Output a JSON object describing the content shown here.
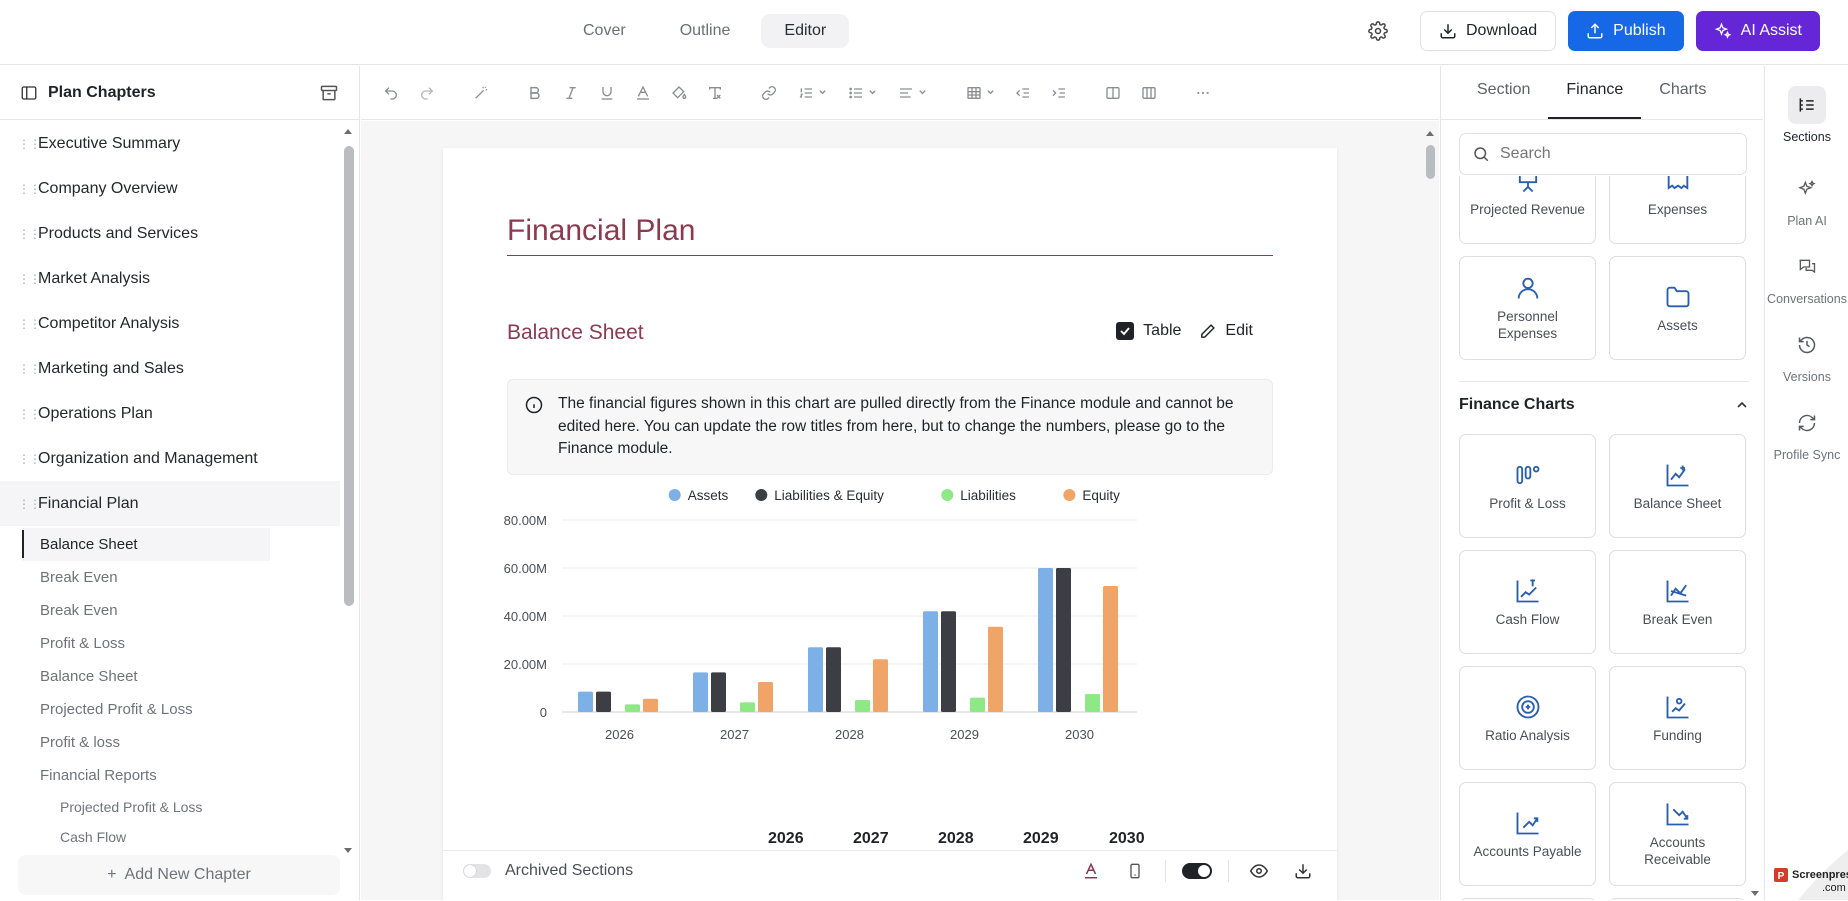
{
  "top_tabs": [
    {
      "label": "Cover",
      "active": false
    },
    {
      "label": "Outline",
      "active": false
    },
    {
      "label": "Editor",
      "active": true
    }
  ],
  "actions": {
    "download": "Download",
    "publish": "Publish",
    "ai_assist": "AI Assist"
  },
  "sidebar": {
    "title": "Plan Chapters",
    "chapters": [
      "Executive Summary",
      "Company Overview",
      "Products and Services",
      "Market Analysis",
      "Competitor Analysis",
      "Marketing and Sales",
      "Operations Plan",
      "Organization and Management",
      "Financial Plan"
    ],
    "sub_items": [
      "Balance Sheet",
      "Break Even",
      "Break Even",
      "Profit & Loss",
      "Balance Sheet",
      "Projected Profit & Loss",
      "Profit & loss",
      "Financial Reports"
    ],
    "sub_sub_items": [
      "Projected Profit & Loss",
      "Cash Flow"
    ],
    "add_chapter": "Add New Chapter"
  },
  "document": {
    "title": "Financial Plan",
    "section_title": "Balance Sheet",
    "table_label": "Table",
    "edit_label": "Edit",
    "info_text": "The financial figures shown in this chart are pulled directly from the Finance module and cannot be edited here. You can update the row titles from here, but to change the numbers, please go to the Finance module.",
    "table_years": [
      "2026",
      "2027",
      "2028",
      "2029",
      "2030"
    ],
    "archived_label": "Archived Sections"
  },
  "chart_data": {
    "type": "bar",
    "categories": [
      "2026",
      "2027",
      "2028",
      "2029",
      "2030"
    ],
    "series": [
      {
        "name": "Assets",
        "color": "#7db0e6",
        "values": [
          8.5,
          16.5,
          27,
          42,
          60
        ]
      },
      {
        "name": "Liabilities & Equity",
        "color": "#3c3e44",
        "values": [
          8.5,
          16.5,
          27,
          42,
          60
        ]
      },
      {
        "name": "Liabilities",
        "color": "#8ee886",
        "values": [
          3.2,
          4,
          5,
          6,
          7.5
        ]
      },
      {
        "name": "Equity",
        "color": "#f0a468",
        "values": [
          5.5,
          12.5,
          22,
          35.5,
          52.5
        ]
      }
    ],
    "ylim": [
      0,
      80
    ],
    "ytick_values": [
      0,
      20,
      40,
      60,
      80
    ],
    "ytick_labels": [
      "0",
      "20.00M",
      "40.00M",
      "60.00M",
      "80.00M"
    ],
    "legend_position": "top-right",
    "grid": true
  },
  "right_panel": {
    "tabs": [
      {
        "label": "Section",
        "active": false
      },
      {
        "label": "Finance",
        "active": true
      },
      {
        "label": "Charts",
        "active": false
      }
    ],
    "search_placeholder": "Search",
    "top_cards": [
      {
        "label": "Projected Revenue",
        "icon": "revenue-icon"
      },
      {
        "label": "Expenses",
        "icon": "expenses-icon"
      },
      {
        "label": "Personnel Expenses",
        "icon": "user-icon"
      },
      {
        "label": "Assets",
        "icon": "folder-icon"
      }
    ],
    "group_title": "Finance Charts",
    "chart_cards": [
      {
        "label": "Profit & Loss",
        "icon": "profit-loss-icon"
      },
      {
        "label": "Balance Sheet",
        "icon": "balance-sheet-icon"
      },
      {
        "label": "Cash Flow",
        "icon": "cash-flow-icon"
      },
      {
        "label": "Break Even",
        "icon": "break-even-icon"
      },
      {
        "label": "Ratio Analysis",
        "icon": "ratio-icon"
      },
      {
        "label": "Funding",
        "icon": "funding-icon"
      },
      {
        "label": "Accounts Payable",
        "icon": "payable-icon"
      },
      {
        "label": "Accounts Receivable",
        "icon": "receivable-icon"
      }
    ]
  },
  "rail": [
    {
      "label": "Sections",
      "active": true
    },
    {
      "label": "Plan AI",
      "active": false
    },
    {
      "label": "Conversations",
      "active": false
    },
    {
      "label": "Versions",
      "active": false
    },
    {
      "label": "Profile Sync",
      "active": false
    }
  ],
  "watermark": "Screenpresso .com"
}
